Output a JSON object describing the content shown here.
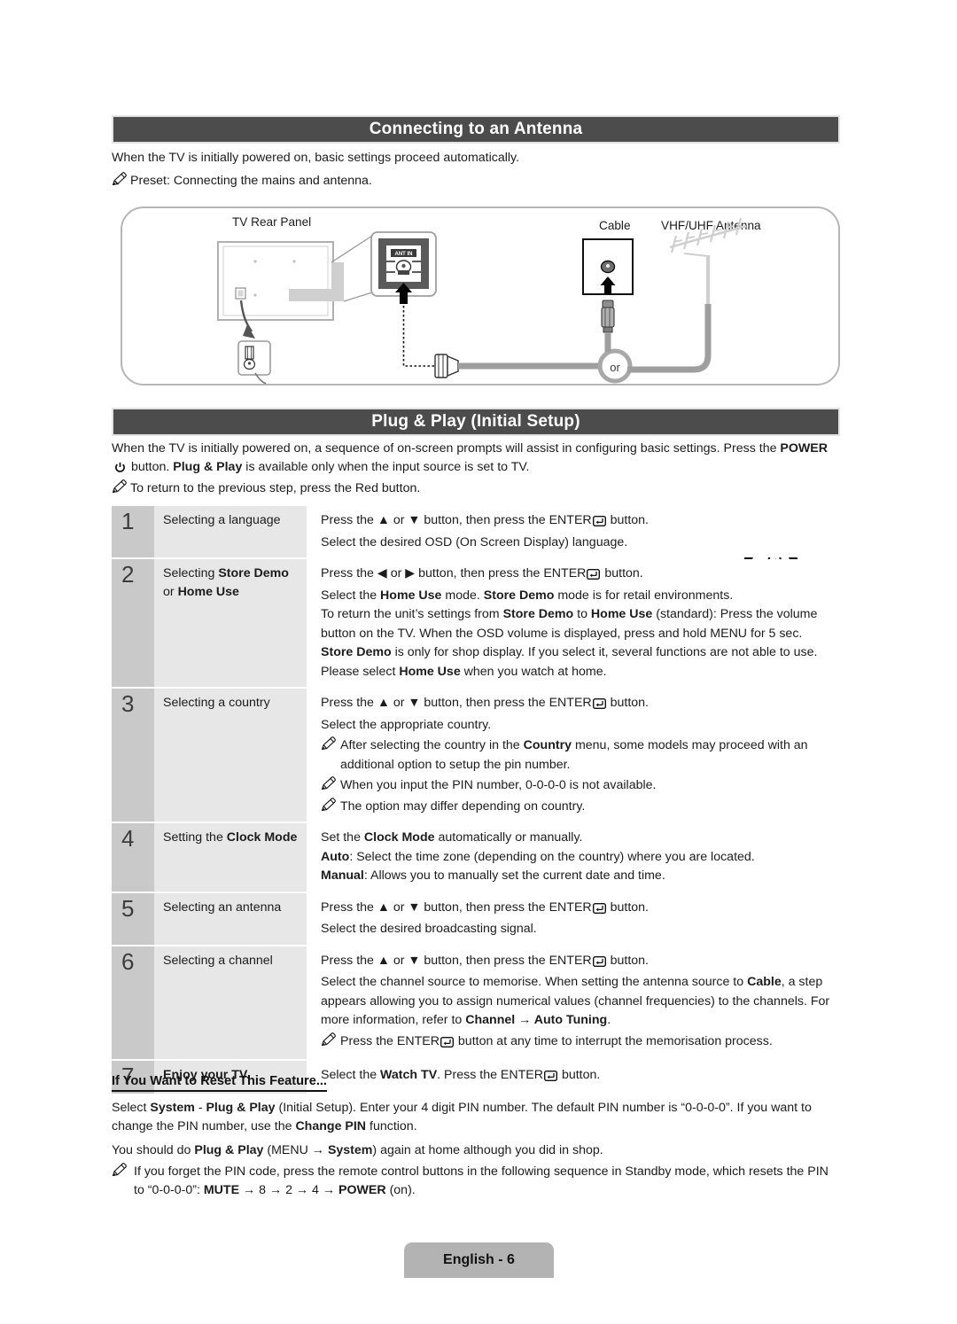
{
  "section1": {
    "title": "Connecting to an Antenna",
    "intro": "When the TV is initially powered on, basic settings proceed automatically.",
    "note": "Preset: Connecting the mains and antenna.",
    "diagram": {
      "label_tv": "TV Rear Panel",
      "label_cable": "Cable",
      "label_antenna": "VHF/UHF Antenna",
      "label_or": "or",
      "label_ant_in": "ANT IN"
    }
  },
  "section2": {
    "title": "Plug & Play (Initial Setup)",
    "intro_a": "When the TV is initially powered on, a sequence of on-screen prompts will assist in configuring basic settings. Press the ",
    "intro_power": "POWER",
    "intro_b": " button. ",
    "intro_pp": "Plug & Play",
    "intro_c": " is available only when the input source is set to TV.",
    "note": "To return to the previous step, press the Red button.",
    "power_illustration_label": "POWER"
  },
  "steps": [
    {
      "number": "1",
      "label_parts": [
        {
          "t": "Selecting a language",
          "b": false
        }
      ],
      "lines": [
        {
          "kind": "text",
          "parts": [
            {
              "t": "Press the ",
              "b": false
            },
            {
              "t": "▲",
              "b": false
            },
            {
              "t": " or ",
              "b": false
            },
            {
              "t": "▼",
              "b": false
            },
            {
              "t": " button, then press the ENTER",
              "b": false
            },
            {
              "t": "ENTER_ICON",
              "b": false
            },
            {
              "t": " button.",
              "b": false
            }
          ]
        },
        {
          "kind": "text",
          "parts": [
            {
              "t": "Select the desired OSD (On Screen Display) language.",
              "b": false
            }
          ]
        }
      ]
    },
    {
      "number": "2",
      "label_parts": [
        {
          "t": "Selecting ",
          "b": false
        },
        {
          "t": "Store Demo",
          "b": true
        },
        {
          "t": " or ",
          "b": false
        },
        {
          "t": "Home Use",
          "b": true
        }
      ],
      "lines": [
        {
          "kind": "enter_lr",
          "parts": []
        },
        {
          "kind": "text",
          "parts": [
            {
              "t": "Select the ",
              "b": false
            },
            {
              "t": "Home Use",
              "b": true
            },
            {
              "t": " mode. ",
              "b": false
            },
            {
              "t": "Store Demo",
              "b": true
            },
            {
              "t": " mode is for retail environments.",
              "b": false
            }
          ]
        },
        {
          "kind": "text",
          "parts": [
            {
              "t": "To return the unit’s settings from ",
              "b": false
            },
            {
              "t": "Store Demo",
              "b": true
            },
            {
              "t": " to ",
              "b": false
            },
            {
              "t": "Home Use",
              "b": true
            },
            {
              "t": " (standard): Press the volume button on the TV. When the OSD volume is displayed, press and hold ",
              "b": false
            },
            {
              "t": "MENU",
              "b": false
            },
            {
              "t": " for 5 sec.",
              "b": false
            }
          ]
        },
        {
          "kind": "text",
          "parts": [
            {
              "t": "Store Demo",
              "b": true
            },
            {
              "t": " is only for shop display. If you select it, several functions are not able to use. Please select ",
              "b": false
            },
            {
              "t": "Home Use",
              "b": true
            },
            {
              "t": " when you watch at home.",
              "b": false
            }
          ]
        }
      ]
    },
    {
      "number": "3",
      "label_parts": [
        {
          "t": "Selecting a country",
          "b": false
        }
      ],
      "lines": [
        {
          "kind": "enter_ud",
          "parts": []
        },
        {
          "kind": "text",
          "parts": [
            {
              "t": "Select the appropriate country.",
              "b": false
            }
          ]
        },
        {
          "kind": "note",
          "parts": [
            {
              "t": "After selecting the country in the ",
              "b": false
            },
            {
              "t": "Country",
              "b": true
            },
            {
              "t": " menu, some models may proceed with an additional option to setup the pin number.",
              "b": false
            }
          ]
        },
        {
          "kind": "note",
          "parts": [
            {
              "t": "When you input the PIN number, 0-0-0-0 is not available.",
              "b": false
            }
          ]
        },
        {
          "kind": "note",
          "parts": [
            {
              "t": "The option may differ depending on country.",
              "b": false
            }
          ]
        }
      ]
    },
    {
      "number": "4",
      "label_parts": [
        {
          "t": "Setting the ",
          "b": false
        },
        {
          "t": "Clock Mode",
          "b": true
        }
      ],
      "lines": [
        {
          "kind": "text",
          "parts": [
            {
              "t": "Set the ",
              "b": false
            },
            {
              "t": "Clock Mode",
              "b": true
            },
            {
              "t": " automatically or manually.",
              "b": false
            }
          ]
        },
        {
          "kind": "text",
          "parts": [
            {
              "t": "Auto",
              "b": true
            },
            {
              "t": ": Select the time zone (depending on the country) where you are located.",
              "b": false
            }
          ]
        },
        {
          "kind": "text",
          "parts": [
            {
              "t": "Manual",
              "b": true
            },
            {
              "t": ": Allows you to manually set the current date and time.",
              "b": false
            }
          ]
        }
      ]
    },
    {
      "number": "5",
      "label_parts": [
        {
          "t": "Selecting an antenna",
          "b": false
        }
      ],
      "lines": [
        {
          "kind": "enter_ud",
          "parts": []
        },
        {
          "kind": "text",
          "parts": [
            {
              "t": "Select the desired broadcasting signal.",
              "b": false
            }
          ]
        }
      ]
    },
    {
      "number": "6",
      "label_parts": [
        {
          "t": "Selecting a channel",
          "b": false
        }
      ],
      "lines": [
        {
          "kind": "enter_ud",
          "parts": []
        },
        {
          "kind": "text",
          "parts": [
            {
              "t": "Select the channel source to memorise. When setting the antenna source to ",
              "b": false
            },
            {
              "t": "Cable",
              "b": true
            },
            {
              "t": ", a step appears allowing you to assign numerical values (channel frequencies) to the channels. For more information, refer to ",
              "b": false
            },
            {
              "t": "Channel → Auto Tuning",
              "b": true
            },
            {
              "t": ".",
              "b": false
            }
          ]
        },
        {
          "kind": "note_enter",
          "parts": [
            {
              "t": "Press the ENTER",
              "b": false
            },
            {
              "t": "ENTER_ICON",
              "b": false
            },
            {
              "t": " button at any time to interrupt the memorisation process.",
              "b": false
            }
          ]
        }
      ]
    },
    {
      "number": "7",
      "label_parts": [
        {
          "t": "Enjoy your TV.",
          "b": true
        }
      ],
      "lines": [
        {
          "kind": "text_enter_watch",
          "parts": [
            {
              "t": "Select the ",
              "b": false
            },
            {
              "t": "Watch TV",
              "b": true
            },
            {
              "t": ". Press the ENTER",
              "b": false
            },
            {
              "t": "ENTER_ICON",
              "b": false
            },
            {
              "t": " button.",
              "b": false
            }
          ]
        }
      ]
    }
  ],
  "reset": {
    "heading": "If You Want to Reset This Feature...",
    "p1_parts": [
      {
        "t": "Select ",
        "b": false
      },
      {
        "t": "System",
        "b": true
      },
      {
        "t": " - ",
        "b": false
      },
      {
        "t": "Plug & Play",
        "b": true
      },
      {
        "t": " (Initial Setup). Enter your 4 digit PIN number. The default PIN number is “0-0-0-0”. If you want to change the PIN number, use the ",
        "b": false
      },
      {
        "t": "Change PIN",
        "b": true
      },
      {
        "t": " function.",
        "b": false
      }
    ],
    "p2_parts": [
      {
        "t": "You should do ",
        "b": false
      },
      {
        "t": "Plug & Play",
        "b": true
      },
      {
        "t": " (MENU → ",
        "b": false
      },
      {
        "t": "System",
        "b": true
      },
      {
        "t": ") again at home although you did in shop.",
        "b": false
      }
    ],
    "note_parts": [
      {
        "t": "If you forget the PIN code, press the remote control buttons in the following sequence in Standby mode, which resets the PIN to “0-0-0-0”: ",
        "b": false
      },
      {
        "t": "MUTE",
        "b": true
      },
      {
        "t": " → 8 → 2 → 4 → ",
        "b": false
      },
      {
        "t": "POWER",
        "b": true
      },
      {
        "t": " (on).",
        "b": false
      }
    ]
  },
  "footer": {
    "label": "English - 6"
  },
  "colors": {
    "bar_bg": "#4c4c4c",
    "num_cell": "#c9c9c9",
    "label_cell": "#e7e7e7",
    "footer_bg": "#b3b3b3",
    "diagram_border": "#b6b6b6"
  }
}
